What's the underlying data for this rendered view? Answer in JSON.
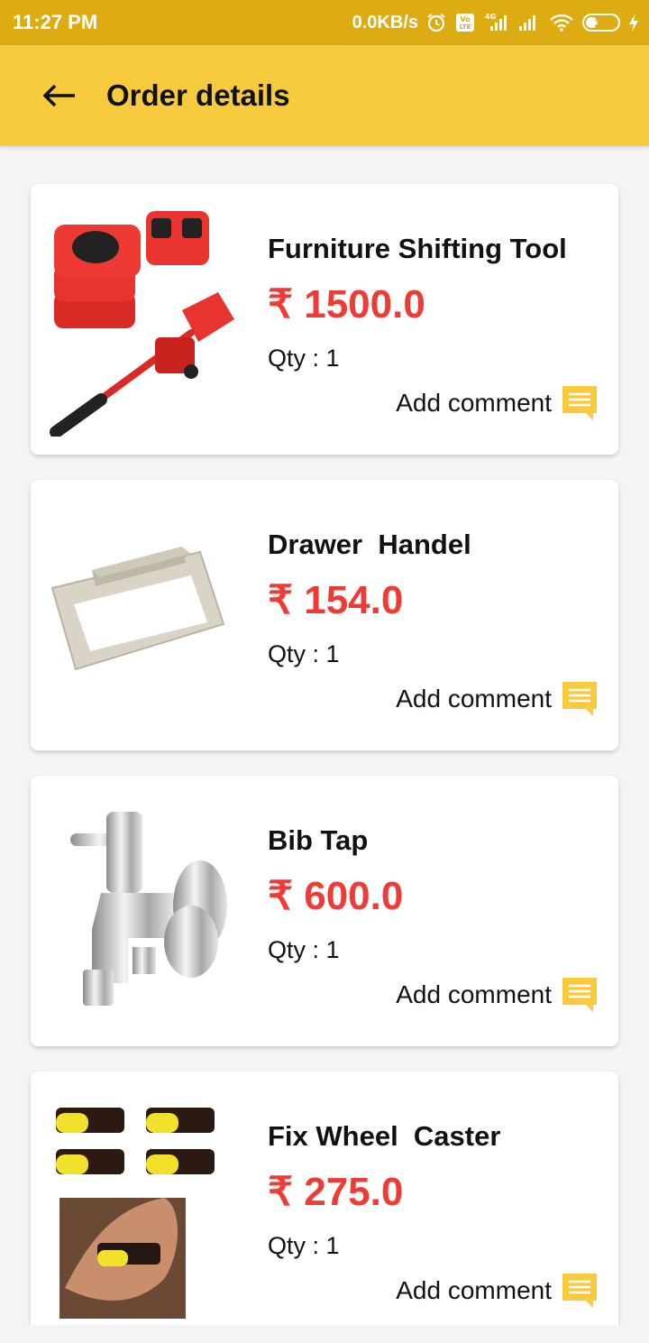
{
  "status_bar": {
    "time": "11:27 PM",
    "network_speed": "0.0KB/s",
    "battery_level": "37",
    "battery_percent": 37,
    "icons": [
      "alarm-icon",
      "volte-icon",
      "signal-4g-icon",
      "signal-icon",
      "wifi-icon",
      "battery-icon",
      "charging-icon"
    ]
  },
  "header": {
    "back_icon": "arrow-left-icon",
    "title": "Order details"
  },
  "orders": [
    {
      "name": "Furniture Shifting Tool",
      "price": "₹ 1500.0",
      "qty": "Qty : 1",
      "comment_label": "Add comment",
      "image": "furniture-shifting-tool-image"
    },
    {
      "name": "Drawer  Handel",
      "price": "₹ 154.0",
      "qty": "Qty : 1",
      "comment_label": "Add comment",
      "image": "drawer-handle-image"
    },
    {
      "name": "Bib Tap",
      "price": "₹ 600.0",
      "qty": "Qty : 1",
      "comment_label": "Add comment",
      "image": "bib-tap-image"
    },
    {
      "name": "Fix Wheel  Caster",
      "price": "₹ 275.0",
      "qty": "Qty : 1",
      "comment_label": "Add comment",
      "image": "wheel-caster-image"
    }
  ],
  "colors": {
    "status_bar": "#dcac12",
    "app_bar": "#f8cb3f",
    "price": "#ef3b36",
    "comment_icon": "#f8cb3f",
    "background": "#f4f4f4"
  }
}
